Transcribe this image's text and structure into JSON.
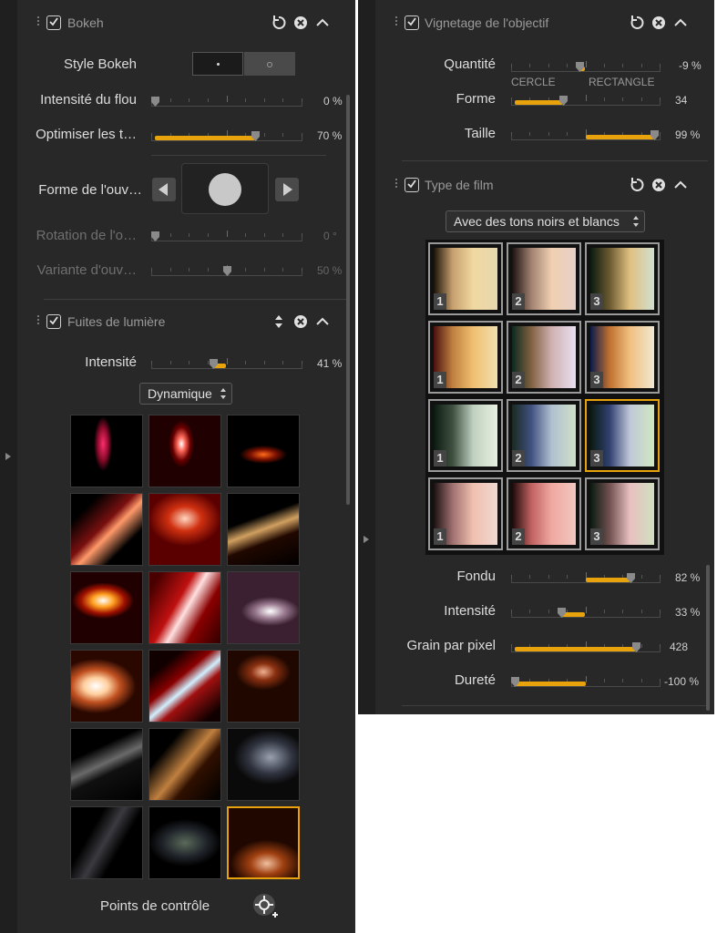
{
  "left": {
    "bokeh": {
      "title": "Bokeh",
      "style_label": "Style Bokeh",
      "rows": [
        {
          "label": "Intensité du flou",
          "value": "0 %",
          "fraction": 0.0
        },
        {
          "label": "Optimiser les t…",
          "value": "70 %",
          "fraction": 0.7
        }
      ],
      "aperture_label": "Forme de l'ouv…",
      "disabled_rows": [
        {
          "label": "Rotation de l'o…",
          "value": "0 °",
          "fraction": 0.0
        },
        {
          "label": "Variante d'ouv…",
          "value": "50 %",
          "fraction": 0.5
        }
      ]
    },
    "light_leaks": {
      "title": "Fuites de lumière",
      "intensity_label": "Intensité",
      "intensity_value": "41 %",
      "intensity_fraction": 0.41,
      "mode": "Dynamique",
      "control_points_label": "Points de contrôle",
      "thumbnails_selected_index": 17
    }
  },
  "right": {
    "vignetting": {
      "title": "Vignetage de l'objectif",
      "rows": [
        {
          "label": "Quantité",
          "value": "-9 %",
          "fraction": 0.455,
          "origin": 0.5
        },
        {
          "label": "Forme",
          "value": "34",
          "fraction": 0.34,
          "origin": 0.0
        },
        {
          "label": "Taille",
          "value": "99 %",
          "fraction": 0.99,
          "origin": 0.5
        }
      ],
      "forme_left": "CERCLE",
      "forme_right": "RECTANGLE"
    },
    "film_type": {
      "title": "Type de film",
      "preset": "Avec des tons noirs et blancs",
      "selected_index": 8,
      "numbers": [
        "1",
        "2",
        "3"
      ],
      "rows": [
        {
          "label": "Fondu",
          "value": "82 %",
          "fraction": 0.82,
          "origin": 0.5
        },
        {
          "label": "Intensité",
          "value": "33 %",
          "fraction": 0.33,
          "origin": 0.5
        },
        {
          "label": "Grain par pixel",
          "value": "428",
          "fraction": 0.86,
          "origin": 0.0
        },
        {
          "label": "Dureté",
          "value": "-100 %",
          "fraction": 0.0,
          "origin": 0.5
        }
      ]
    }
  },
  "colors": {
    "accent": "#e8a30c",
    "panel": "#282828"
  }
}
